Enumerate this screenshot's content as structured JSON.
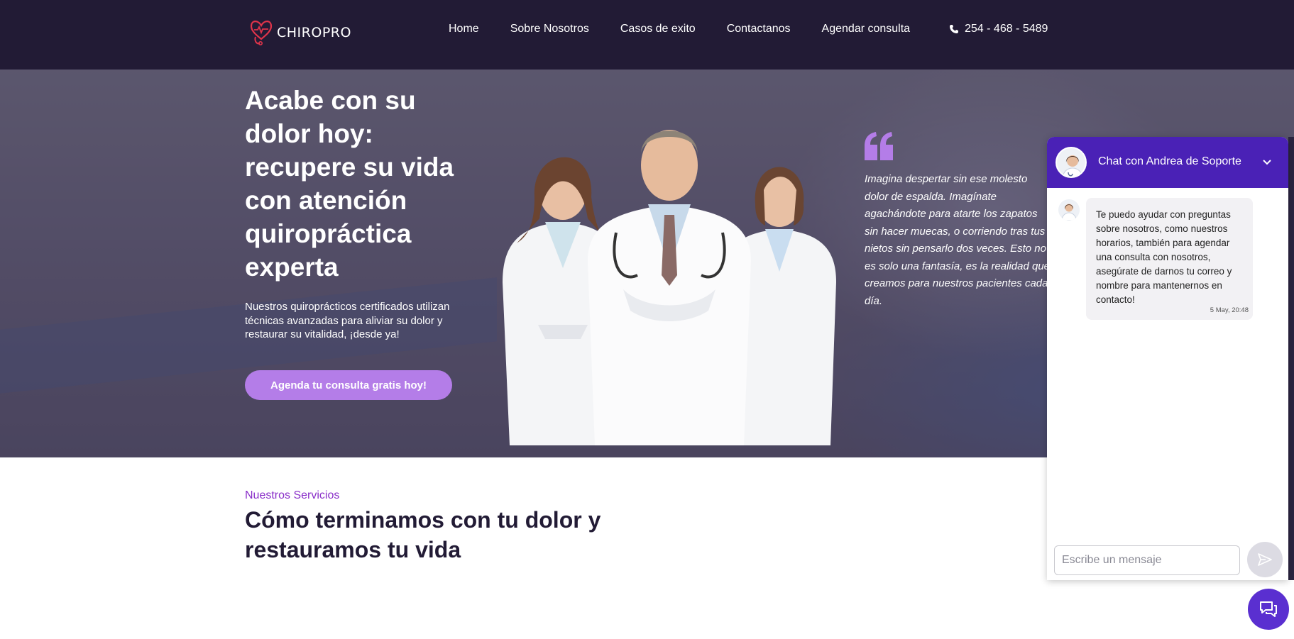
{
  "brand": {
    "name": "CHIROPRO",
    "logo_icon": "heart-stethoscope-icon",
    "accent": "#e0344a"
  },
  "nav": {
    "links": [
      "Home",
      "Sobre Nosotros",
      "Casos de exito",
      "Contactanos",
      "Agendar consulta"
    ],
    "phone": "254 - 468 - 5489",
    "phone_icon": "phone-icon"
  },
  "hero": {
    "title": "Acabe con su dolor hoy: recupere su vida con atención quiropráctica experta",
    "subtitle": "Nuestros quiroprácticos certificados utilizan técnicas avanzadas para aliviar su dolor y restaurar su vitalidad, ¡desde ya!",
    "cta_label": "Agenda tu consulta gratis hoy!",
    "quote": "Imagina despertar sin ese molesto dolor de espalda. Imagínate agachándote para atarte los zapatos sin hacer muecas, o corriendo tras tus nietos sin pensarlo dos veces. Esto no es solo una fantasía, es la realidad que creamos para nuestros pacientes cada día.",
    "quote_icon": "quote-icon",
    "accent": "#b47de8"
  },
  "services": {
    "label": "Nuestros Servicios",
    "title": "Cómo terminamos con tu dolor y restauramos tu vida"
  },
  "chat": {
    "title": "Chat con Andrea de Soporte",
    "message": "Te puedo ayudar con preguntas sobre nosotros, como nuestros horarios, también para agendar una consulta con nosotros, asegúrate de darnos tu correo y nombre para mantenernos en contacto!",
    "time": "5 May, 20:48",
    "input_placeholder": "Escribe un mensaje",
    "header_color": "#4a21b6",
    "launcher_icon": "chat-bubbles-icon",
    "send_icon": "send-icon"
  }
}
